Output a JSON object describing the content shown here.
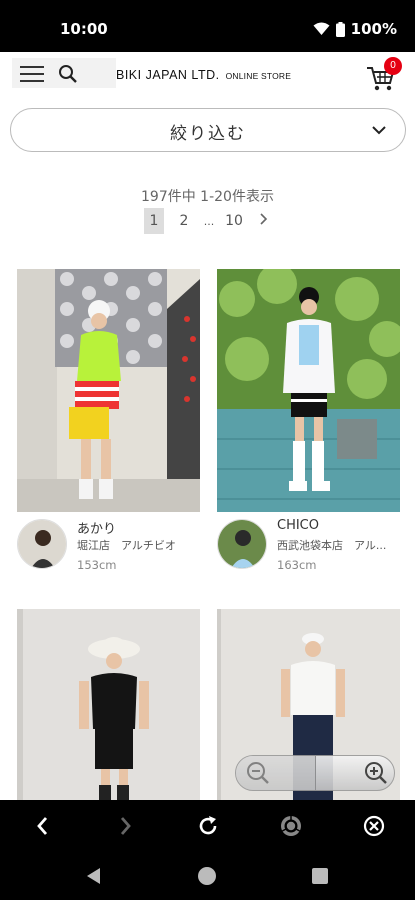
{
  "status_bar": {
    "time": "10:00",
    "battery": "100%"
  },
  "header": {
    "logo": "BIKI JAPAN LTD.",
    "logo_sub": "ONLINE STORE",
    "cart_count": "0",
    "accent_color": "#e50012"
  },
  "filter": {
    "label": "絞り込む"
  },
  "results": {
    "summary": "197件中 1-20件表示",
    "pages": [
      "1",
      "2",
      "...",
      "10"
    ],
    "current_page": "1"
  },
  "staff": [
    {
      "name": "あかり",
      "store": "堀江店　アルチビオ",
      "height": "153cm"
    },
    {
      "name": "CHICO",
      "store": "西武池袋本店　アル...",
      "height": "163cm"
    },
    {
      "name": "",
      "store": "",
      "height": ""
    },
    {
      "name": "",
      "store": "",
      "height": ""
    }
  ],
  "icons": {
    "menu": "hamburger-icon",
    "search": "search-icon",
    "cart": "cart-icon",
    "chevron": "chevron-down-icon",
    "back": "back-icon",
    "forward": "forward-icon",
    "reload": "reload-icon",
    "chrome": "chrome-icon",
    "close": "close-icon"
  }
}
